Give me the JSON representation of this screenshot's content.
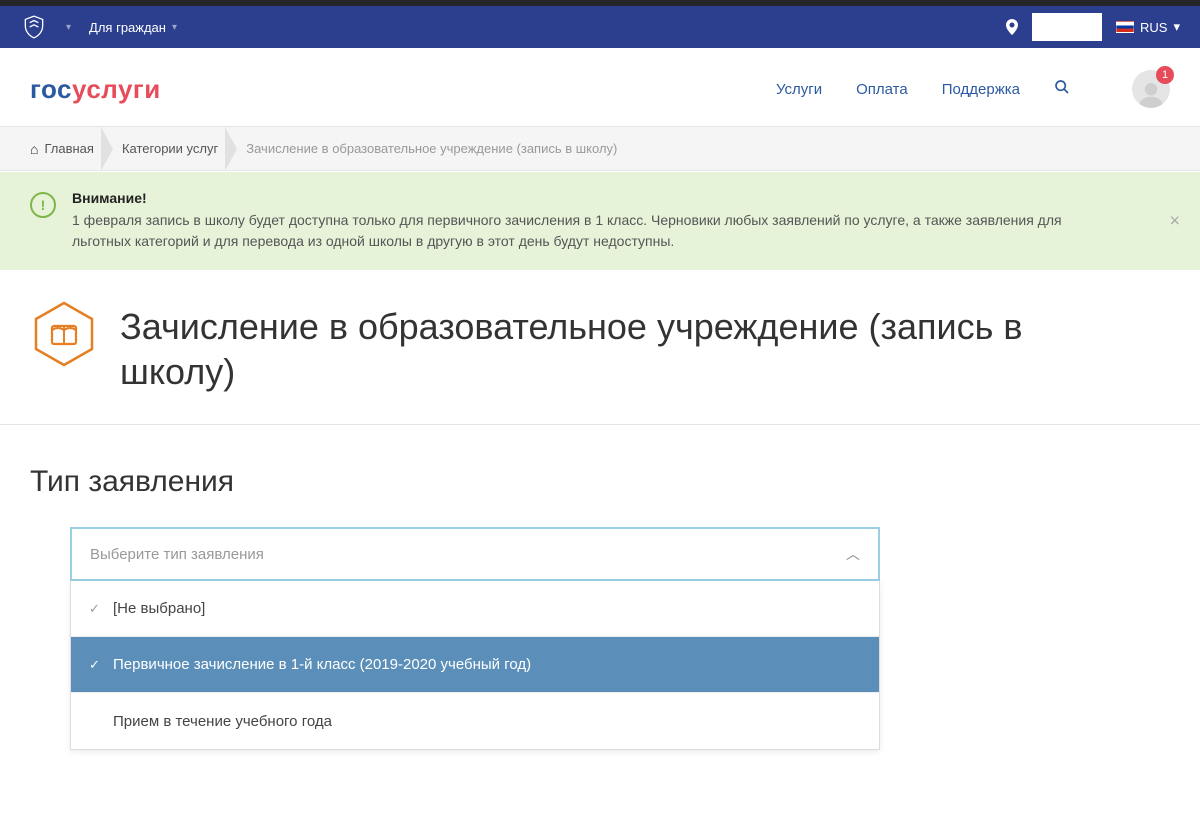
{
  "govbar": {
    "audience_label": "Для граждан",
    "language": "RUS"
  },
  "logo": {
    "part1": "гос",
    "part2": "услуги"
  },
  "nav": {
    "services": "Услуги",
    "payment": "Оплата",
    "support": "Поддержка"
  },
  "notifications_count": "1",
  "breadcrumb": {
    "home": "Главная",
    "categories": "Категории услуг",
    "current": "Зачисление в образовательное учреждение (запись в школу)"
  },
  "alert": {
    "title": "Внимание!",
    "text": "1 февраля запись в школу будет доступна только для первичного зачисления в 1 класс. Черновики любых заявлений по услуге, а также заявления для льготных категорий и для перевода из одной школы в другую в этот день будут недоступны."
  },
  "page_title": "Зачисление в образовательное учреждение (запись в школу)",
  "form": {
    "heading": "Тип заявления",
    "placeholder": "Выберите тип заявления",
    "options": {
      "none": "[Не выбрано]",
      "primary": "Первичное зачисление в 1-й класс (2019-2020 учебный год)",
      "during_year": "Прием в течение учебного года"
    }
  }
}
